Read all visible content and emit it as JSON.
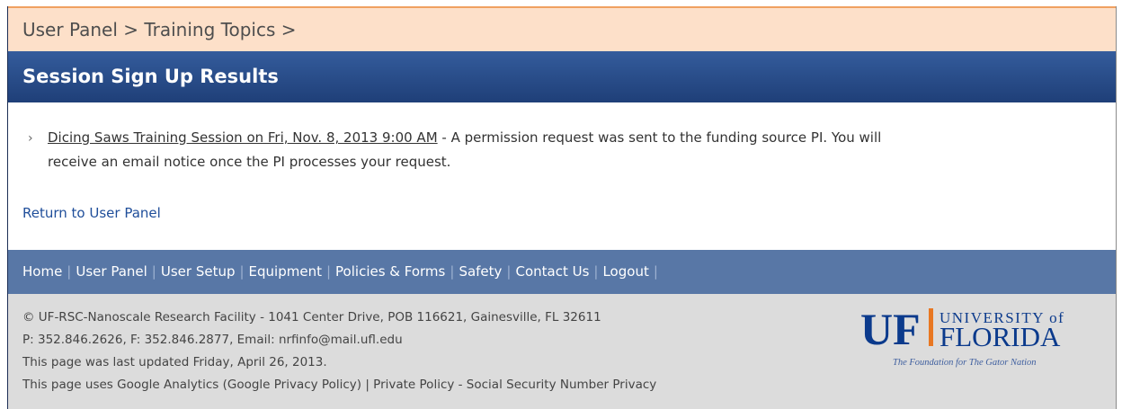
{
  "breadcrumb": {
    "text": "User Panel > Training Topics >"
  },
  "header": {
    "title": "Session Sign Up Results"
  },
  "result": {
    "link_text": "Dicing Saws Training Session on Fri, Nov. 8, 2013 9:00 AM",
    "message_line1": " - A permission request was sent to the funding source PI. You will",
    "message_line2": "receive an email notice once the PI processes your request."
  },
  "return_link": "Return to User Panel",
  "nav": {
    "items": [
      "Home",
      "User Panel",
      "User Setup",
      "Equipment",
      "Policies & Forms",
      "Safety",
      "Contact Us",
      "Logout"
    ]
  },
  "footer": {
    "lines": [
      "© UF-RSC-Nanoscale Research Facility - 1041 Center Drive, POB 116621, Gainesville, FL 32611",
      "P: 352.846.2626, F: 352.846.2877, Email: nrfinfo@mail.ufl.edu",
      "This page was last updated Friday, April 26, 2013.",
      "This page uses Google Analytics (Google Privacy Policy) | Private Policy - Social Security Number Privacy"
    ]
  },
  "logo": {
    "uf": "UF",
    "university_of": "UNIVERSITY of",
    "florida": "FLORIDA",
    "tagline": "The Foundation for The Gator Nation"
  },
  "colors": {
    "breadcrumb_bg": "#fde0c9",
    "title_bg": "#2a4c8a",
    "nav_bg": "#5877a6",
    "footer_bg": "#dcdcdc",
    "uf_blue": "#0b3a8c",
    "uf_orange": "#e87722"
  }
}
